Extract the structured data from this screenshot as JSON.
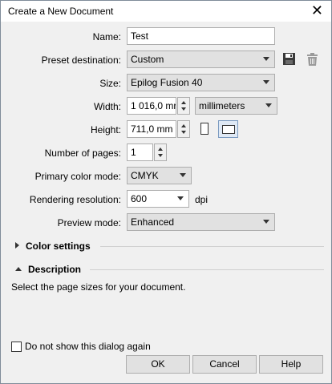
{
  "dialog": {
    "title": "Create a New Document",
    "close_icon": "close-icon"
  },
  "form": {
    "name_label": "Name:",
    "name_value": "Test",
    "preset_label": "Preset destination:",
    "preset_value": "Custom",
    "size_label": "Size:",
    "size_value": "Epilog Fusion 40",
    "width_label": "Width:",
    "width_value": "1 016,0 mr",
    "units_value": "millimeters",
    "height_label": "Height:",
    "height_value": "711,0 mm",
    "pages_label": "Number of pages:",
    "pages_value": "1",
    "color_mode_label": "Primary color mode:",
    "color_mode_value": "CMYK",
    "resolution_label": "Rendering resolution:",
    "resolution_value": "600",
    "resolution_unit": "dpi",
    "preview_label": "Preview mode:",
    "preview_value": "Enhanced"
  },
  "sections": {
    "color_settings": "Color settings",
    "description": "Description",
    "description_text": "Select the page sizes for your document."
  },
  "footer": {
    "dont_show_label": "Do not show this dialog again",
    "ok": "OK",
    "cancel": "Cancel",
    "help": "Help"
  },
  "colors": {
    "background": "#f0f0f0",
    "button": "#e1e1e1",
    "border": "#adadad"
  }
}
